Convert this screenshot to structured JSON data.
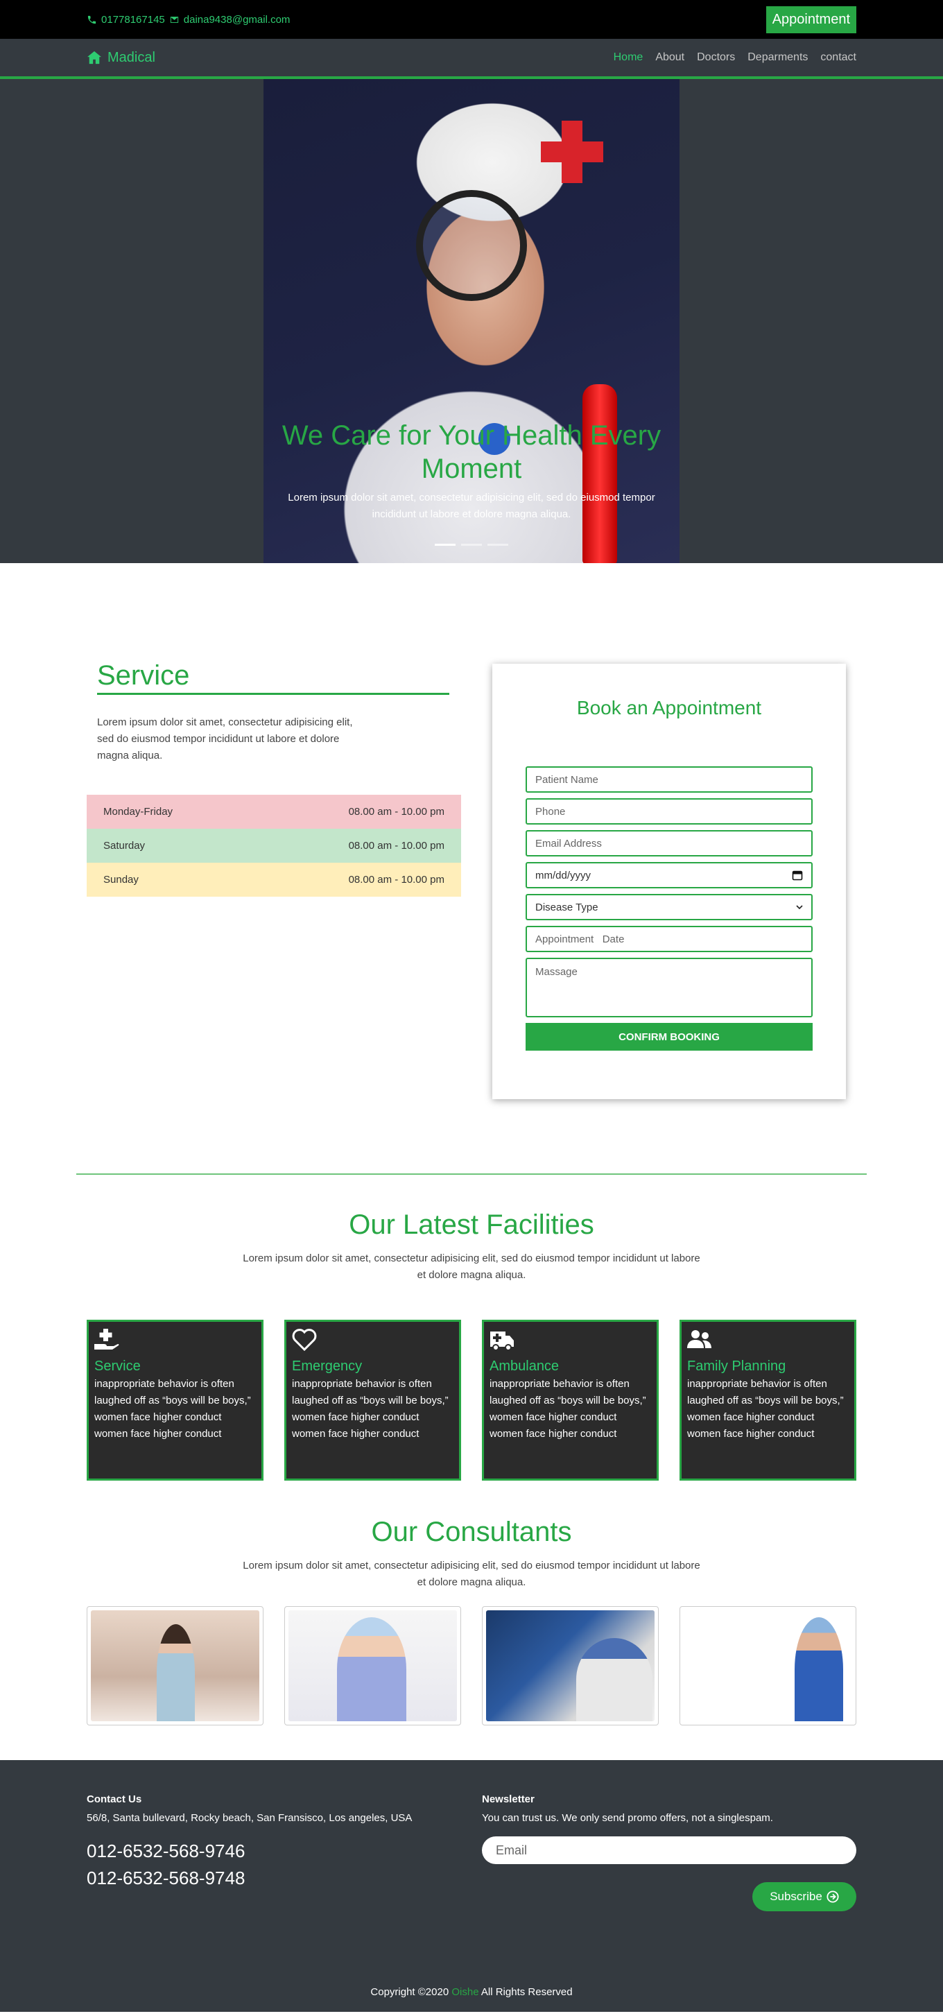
{
  "topbar": {
    "phone": "01778167145",
    "email": "daina9438@gmail.com",
    "appointment_label": "Appointment"
  },
  "nav": {
    "brand": "Madical",
    "items": [
      "Home",
      "About",
      "Doctors",
      "Deparments",
      "contact"
    ],
    "active": "Home"
  },
  "hero": {
    "title": "We Care for Your Health Every Moment",
    "text": "Lorem ipsum dolor sit amet, consectetur adipisicing elit, sed do eiusmod tempor incididunt ut labore et dolore magna aliqua.",
    "slides": 3,
    "active_slide": 1
  },
  "service": {
    "title": "Service",
    "text": "Lorem ipsum dolor sit amet, consectetur adipisicing elit, sed do eiusmod tempor incididunt ut labore et dolore magna aliqua.",
    "hours": [
      {
        "day": "Monday-Friday",
        "time": "08.00 am - 10.00 pm",
        "color": "#f5c6cb"
      },
      {
        "day": "Saturday",
        "time": "08.00 am - 10.00 pm",
        "color": "#c3e6cb"
      },
      {
        "day": "Sunday",
        "time": "08.00 am - 10.00 pm",
        "color": "#ffeeba"
      }
    ]
  },
  "booking": {
    "title": "Book an Appointment",
    "patient_placeholder": "Patient Name",
    "phone_placeholder": "Phone",
    "email_placeholder": "Email Address",
    "date_value": "mm/dd/yyyy",
    "disease_select": "Disease Type",
    "appt_date_placeholder": "Appointment   Date",
    "message_placeholder": "Massage",
    "confirm_label": "CONFIRM BOOKING"
  },
  "facilities": {
    "title": "Our Latest Facilities",
    "text": "Lorem ipsum dolor sit amet, consectetur adipisicing elit, sed do eiusmod tempor incididunt ut labore et dolore magna aliqua.",
    "items": [
      {
        "icon": "hand-medical-icon",
        "title": "Service",
        "text": "inappropriate behavior is often laughed off as “boys will be boys,” women face higher conduct women face higher conduct"
      },
      {
        "icon": "heart-icon",
        "title": "Emergency",
        "text": "inappropriate behavior is often laughed off as “boys will be boys,” women face higher conduct women face higher conduct"
      },
      {
        "icon": "ambulance-icon",
        "title": "Ambulance",
        "text": "inappropriate behavior is often laughed off as “boys will be boys,” women face higher conduct women face higher conduct"
      },
      {
        "icon": "users-icon",
        "title": "Family Planning",
        "text": "inappropriate behavior is often laughed off as “boys will be boys,” women face higher conduct women face higher conduct"
      }
    ]
  },
  "consultants": {
    "title": "Our Consultants",
    "text": "Lorem ipsum dolor sit amet, consectetur adipisicing elit, sed do eiusmod tempor incididunt ut labore et dolore magna aliqua."
  },
  "footer": {
    "contact_title": "Contact Us",
    "address": "56/8, Santa bullevard, Rocky beach, San Fransisco, Los angeles, USA",
    "phone1": "012-6532-568-9746",
    "phone2": "012-6532-568-9748",
    "newsletter_title": "Newsletter",
    "newsletter_text": "You can trust us. We only send promo offers, not a singlespam.",
    "email_placeholder": "Email",
    "subscribe_label": "Subscribe",
    "copy_prefix": "Copyright ©2020",
    "copy_name": "Oishe",
    "copy_suffix": "All Rights Reserved"
  },
  "colors": {
    "accent": "#28a745",
    "dark": "#343a40",
    "card": "#2b2b2b"
  }
}
